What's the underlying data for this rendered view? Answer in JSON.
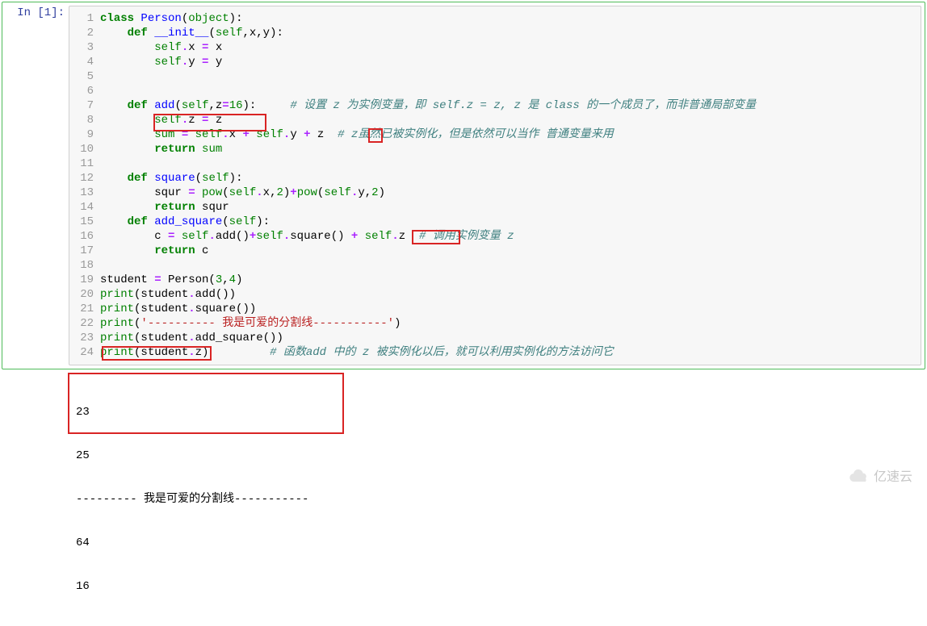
{
  "prompt": "In [1]:",
  "code": {
    "l1": {
      "n": "1",
      "t": "<span class='kw'>class</span> <span class='def'>Person</span>(<span class='builtin'>object</span>):"
    },
    "l2": {
      "n": "2",
      "t": "    <span class='kw'>def</span> <span class='nm'>__init__</span>(<span class='self'>self</span>,x,y):"
    },
    "l3": {
      "n": "3",
      "t": "        <span class='self'>self</span><span class='op'>.</span>x <span class='op'>=</span> x"
    },
    "l4": {
      "n": "4",
      "t": "        <span class='self'>self</span><span class='op'>.</span>y <span class='op'>=</span> y"
    },
    "l5": {
      "n": "5",
      "t": ""
    },
    "l6": {
      "n": "6",
      "t": ""
    },
    "l7": {
      "n": "7",
      "t": "    <span class='kw'>def</span> <span class='def'>add</span>(<span class='self'>self</span>,z<span class='op'>=</span><span class='num'>16</span>):     <span class='comment'># 设置 z 为实例变量，即 self.z = z, z 是 class 的一个成员了，而非普通局部变量</span>"
    },
    "l8": {
      "n": "8",
      "t": "        <span class='self'>self</span><span class='op'>.</span>z <span class='op'>=</span> z"
    },
    "l9": {
      "n": "9",
      "t": "        <span class='builtin'>sum</span> <span class='op'>=</span> <span class='self'>self</span><span class='op'>.</span>x <span class='op'>+</span> <span class='self'>self</span><span class='op'>.</span>y <span class='op'>+</span> z  <span class='comment'># z虽然已被实例化，但是依然可以当作 普通变量来用</span>"
    },
    "l10": {
      "n": "10",
      "t": "        <span class='kw'>return</span> <span class='builtin'>sum</span>"
    },
    "l11": {
      "n": "11",
      "t": ""
    },
    "l12": {
      "n": "12",
      "t": "    <span class='kw'>def</span> <span class='def'>square</span>(<span class='self'>self</span>):"
    },
    "l13": {
      "n": "13",
      "t": "        squr <span class='op'>=</span> <span class='builtin'>pow</span>(<span class='self'>self</span><span class='op'>.</span>x,<span class='num'>2</span>)<span class='op'>+</span><span class='builtin'>pow</span>(<span class='self'>self</span><span class='op'>.</span>y,<span class='num'>2</span>)"
    },
    "l14": {
      "n": "14",
      "t": "        <span class='kw'>return</span> squr"
    },
    "l15": {
      "n": "15",
      "t": "    <span class='kw'>def</span> <span class='def'>add_square</span>(<span class='self'>self</span>):"
    },
    "l16": {
      "n": "16",
      "t": "        c <span class='op'>=</span> <span class='self'>self</span><span class='op'>.</span>add()<span class='op'>+</span><span class='self'>self</span><span class='op'>.</span>square() <span class='op'>+</span> <span class='self'>self</span><span class='op'>.</span>z  <span class='comment'># 调用实例变量 z</span>"
    },
    "l17": {
      "n": "17",
      "t": "        <span class='kw'>return</span> c"
    },
    "l18": {
      "n": "18",
      "t": ""
    },
    "l19": {
      "n": "19",
      "t": "student <span class='op'>=</span> Person(<span class='num'>3</span>,<span class='num'>4</span>)"
    },
    "l20": {
      "n": "20",
      "t": "<span class='builtin'>print</span>(student<span class='op'>.</span>add())"
    },
    "l21": {
      "n": "21",
      "t": "<span class='builtin'>print</span>(student<span class='op'>.</span>square())"
    },
    "l22": {
      "n": "22",
      "t": "<span class='builtin'>print</span>(<span class='str'>'---------- 我是可爱的分割线-----------'</span>)"
    },
    "l23": {
      "n": "23",
      "t": "<span class='builtin'>print</span>(student<span class='op'>.</span>add_square())"
    },
    "l24": {
      "n": "24",
      "t": "<span class='builtin'>print</span>(student<span class='op'>.</span>z)         <span class='comment'># 函数add 中的 z 被实例化以后，就可以利用实例化的方法访问它</span>"
    }
  },
  "output": {
    "o1": "23",
    "o2": "25",
    "o3": "--------- 我是可爱的分割线-----------",
    "o4": "64",
    "o5": "16"
  },
  "watermark": "亿速云"
}
